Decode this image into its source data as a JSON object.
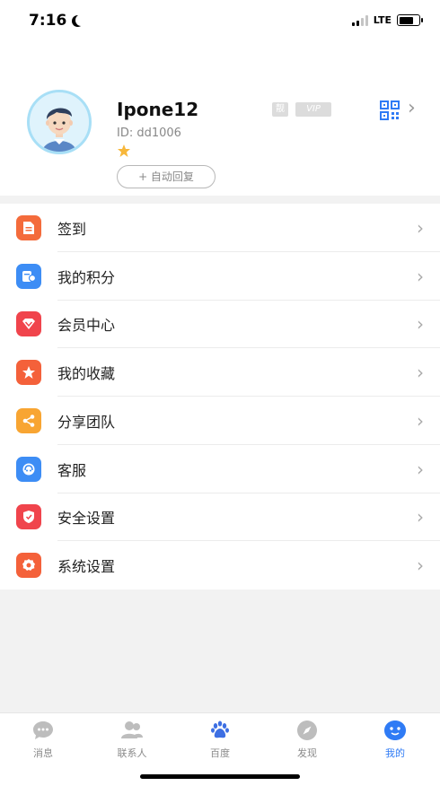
{
  "status_bar": {
    "time": "7:16",
    "network": "LTE"
  },
  "profile": {
    "username": "Ipone12",
    "tag_text": "靓",
    "vip_label": "VIP",
    "user_id": "ID: dd1006",
    "auto_reply_label": "+ 自动回复"
  },
  "menu": {
    "items": [
      {
        "label": "签到",
        "icon": "sign-in-icon",
        "color": "#f46b3b"
      },
      {
        "label": "我的积分",
        "icon": "points-icon",
        "color": "#3d8df5"
      },
      {
        "label": "会员中心",
        "icon": "vip-diamond-icon",
        "color": "#f0444c"
      },
      {
        "label": "我的收藏",
        "icon": "star-icon",
        "color": "#f4613a"
      },
      {
        "label": "分享团队",
        "icon": "share-icon",
        "color": "#f8a532"
      },
      {
        "label": "客服",
        "icon": "customer-service-icon",
        "color": "#3d8df5"
      },
      {
        "label": "安全设置",
        "icon": "shield-icon",
        "color": "#f0444c"
      },
      {
        "label": "系统设置",
        "icon": "gear-icon",
        "color": "#f4613a"
      }
    ]
  },
  "tabs": [
    {
      "label": "消息",
      "icon": "chat-icon"
    },
    {
      "label": "联系人",
      "icon": "contacts-icon"
    },
    {
      "label": "百度",
      "icon": "baidu-paw-icon"
    },
    {
      "label": "发现",
      "icon": "compass-icon"
    },
    {
      "label": "我的",
      "icon": "profile-icon",
      "active": true
    }
  ],
  "colors": {
    "accent": "#2f7bf5",
    "divider": "#ececec",
    "background": "#f2f2f2"
  }
}
